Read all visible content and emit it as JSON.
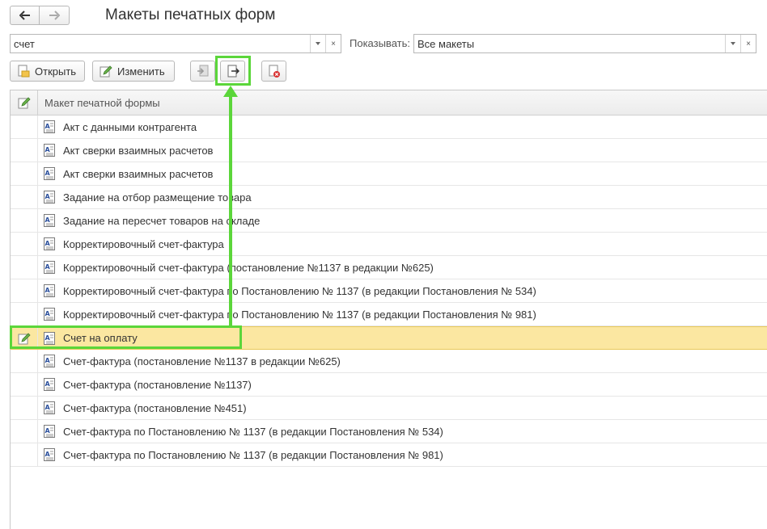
{
  "window": {
    "title": "Макеты печатных форм"
  },
  "search": {
    "value": "счет",
    "clear_glyph": "×"
  },
  "filter": {
    "label": "Показывать:",
    "value": "Все макеты",
    "clear_glyph": "×"
  },
  "toolbar": {
    "open_label": "Открыть",
    "edit_label": "Изменить"
  },
  "grid": {
    "column_header": "Макет печатной формы",
    "rows": [
      {
        "label": "Акт с данными контрагента",
        "selected": false
      },
      {
        "label": "Акт сверки взаимных расчетов",
        "selected": false
      },
      {
        "label": "Акт сверки взаимных расчетов",
        "selected": false
      },
      {
        "label": "Задание на отбор размещение товара",
        "selected": false
      },
      {
        "label": "Задание на пересчет товаров на складе",
        "selected": false
      },
      {
        "label": "Корректировочный счет-фактура",
        "selected": false
      },
      {
        "label": "Корректировочный счет-фактура (постановление №1137 в редакции №625)",
        "selected": false
      },
      {
        "label": "Корректировочный счет-фактура по Постановлению № 1137 (в редакции Постановления № 534)",
        "selected": false
      },
      {
        "label": "Корректировочный счет-фактура по Постановлению № 1137 (в редакции Постановления № 981)",
        "selected": false
      },
      {
        "label": "Счет на оплату",
        "selected": true
      },
      {
        "label": "Счет-фактура (постановление №1137 в редакции №625)",
        "selected": false
      },
      {
        "label": "Счет-фактура (постановление №1137)",
        "selected": false
      },
      {
        "label": "Счет-фактура (постановление №451)",
        "selected": false
      },
      {
        "label": "Счет-фактура по Постановлению № 1137 (в редакции Постановления № 534)",
        "selected": false
      },
      {
        "label": "Счет-фактура по Постановлению № 1137 (в редакции Постановления № 981)",
        "selected": false
      }
    ]
  },
  "colors": {
    "highlight": "#5bd63a",
    "selected_row": "#fbe7a1"
  }
}
